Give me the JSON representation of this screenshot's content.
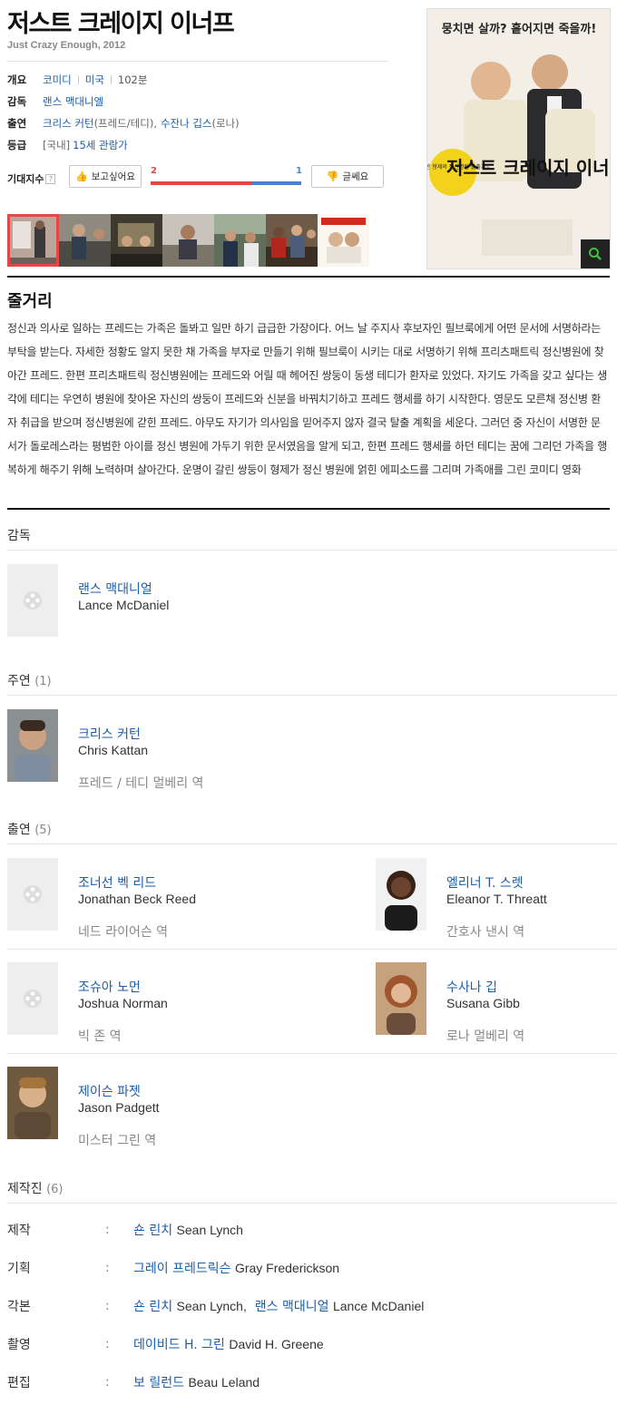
{
  "movie": {
    "title": "저스트 크레이지 이너프",
    "subtitle": "Just Crazy Enough, 2012"
  },
  "info": {
    "overview_label": "개요",
    "genre": "코미디",
    "country": "미국",
    "runtime": "102분",
    "director_label": "감독",
    "director": "랜스 맥대니엘",
    "cast_label": "출연",
    "cast1": "크리스 커턴",
    "cast1_role": "(프레드/테디)",
    "cast_sep": ",",
    "cast2": "수잔나 깁스",
    "cast2_role": "(로나)",
    "rating_label": "등급",
    "rating_prefix": "[국내]",
    "rating": "15세 관람가"
  },
  "expect": {
    "label": "기대지수",
    "help": "?",
    "want_label": "보고싶어요",
    "meh_label": "글쎄요",
    "want_count": "2",
    "meh_count": "1",
    "want_fraction": 0.667
  },
  "poster": {
    "top_text": "뭉치면 살까? 흩어지면 죽을까!",
    "title_text": "저스트 크레이지 이너프",
    "badge_text": "수상한 형제의 정신병원 탈출기~"
  },
  "synopsis": {
    "title": "줄거리",
    "text": "정신과 의사로 일하는 프레드는 가족은 돌봐고 일만 하기 급급한 가장이다. 어느 날 주지사 후보자인 필브룩에게 어떤 문서에 서명하라는 부탁을 받는다. 자세한 정황도 알지 못한 채 가족을 부자로 만들기 위해 필브룩이 시키는 대로 서명하기 위해 프리츠패트릭 정신병원에 찾아간 프레드. 한편 프리츠패트릭 정신병원에는 프레드와 어릴 때 헤어진 쌍둥이 동생 테디가 환자로 있었다. 자기도 가족을 갖고 싶다는 생각에 테디는 우연히 병원에 찾아온 자신의 쌍둥이 프레드와 신분을 바꿔치기하고 프레드 행세를 하기 시작한다. 영문도 모른채 정신병 환자 취급을 받으며 정신병원에 갇힌 프레드. 아무도 자기가 의사임을 믿어주지 않자 결국 탈출 계획을 세운다. 그러던 중 자신이 서명한 문서가 돌로레스라는 평범한 아이를 정신 병원에 가두기 위한 문서였음을 알게 되고, 한편 프레드 행세를 하던 테디는 꿈에 그리던 가족을 행복하게 해주기 위해 노력하며 살아간다. 운명이 갈린 쌍둥이 형제가 정신 병원에 얽힌 에피소드를 그리며 가족애를 그린 코미디 영화"
  },
  "directors": {
    "title": "감독",
    "people": [
      {
        "name": "랜스 맥대니얼",
        "name_en": "Lance McDaniel",
        "role": ""
      }
    ]
  },
  "lead": {
    "title": "주연",
    "count": "(1)",
    "people": [
      {
        "name": "크리스 커턴",
        "name_en": "Chris Kattan",
        "role": "프레드 / 테디 멀베리 역"
      }
    ]
  },
  "support": {
    "title": "출연",
    "count": "(5)",
    "people": [
      {
        "name": "조너선 벡 리드",
        "name_en": "Jonathan Beck Reed",
        "role": "네드 라이어슨 역"
      },
      {
        "name": "엘리너 T. 스렛",
        "name_en": "Eleanor T. Threatt",
        "role": "간호사 낸시 역"
      },
      {
        "name": "조슈아 노먼",
        "name_en": "Joshua Norman",
        "role": "빅 존 역"
      },
      {
        "name": "수사나 깁",
        "name_en": "Susana Gibb",
        "role": "로나 멀베리 역"
      },
      {
        "name": "제이슨 파젯",
        "name_en": "Jason Padgett",
        "role": "미스터 그린 역"
      }
    ]
  },
  "crew": {
    "title": "제작진",
    "count": "(6)",
    "colon": ":",
    "rows": [
      {
        "label": "제작",
        "name": "숀 린치",
        "name_en": "Sean Lynch"
      },
      {
        "label": "기획",
        "name": "그레이 프레드릭슨",
        "name_en": "Gray Frederickson"
      },
      {
        "label": "각본",
        "name": "숀 린치",
        "name_en": "Sean Lynch,",
        "name2": "랜스 맥대니얼",
        "name2_en": "Lance McDaniel"
      },
      {
        "label": "촬영",
        "name": "데이비드 H. 그린",
        "name_en": "David H. Greene"
      },
      {
        "label": "편집",
        "name": "보 릴런드",
        "name_en": "Beau Leland"
      }
    ]
  },
  "colors": {
    "link": "#1a5dab",
    "want": "#e84545",
    "meh": "#4a7fd8",
    "divider": "#111111"
  }
}
